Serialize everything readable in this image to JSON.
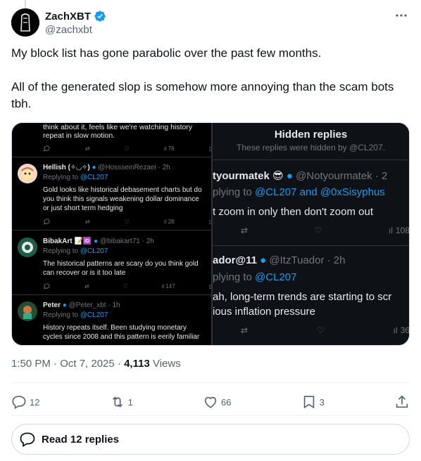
{
  "author": {
    "name": "ZachXBT",
    "handle": "@zachxbt"
  },
  "tweet": {
    "paragraph1": "My block list has gone parabolic over the past few months.",
    "paragraph2": "All of the generated slop is somehow more annoying than the scam bots tbh."
  },
  "screenshot_left": {
    "top_line1": "think about it, feels like we're watching history",
    "top_line2": "repeat in slow motion.",
    "top_views": "78",
    "replies": [
      {
        "name": "Hellish (✧◡✧)",
        "meta": "@HossseinRezaei · 2h",
        "replying_prefix": "Replying to ",
        "replying_to": "@CL207",
        "lines": [
          "Gold looks like historical debasement charts but do",
          "you think this signals weakening dollar dominance",
          "or just short term hedging"
        ],
        "views": "28"
      },
      {
        "name": "BibakArt 📝🆔",
        "meta": "@bibakart71 · 2h",
        "replying_prefix": "Replying to ",
        "replying_to": "@CL207",
        "lines": [
          "The historical patterns are scary do you think gold",
          "can recover or is it too late"
        ],
        "views": "147"
      },
      {
        "name": "Peter",
        "meta": "@Peter_xbt · 1h",
        "replying_prefix": "Replying to ",
        "replying_to": "@CL207",
        "lines": [
          "History repeats itself. Been studying monetary",
          "cycles since 2008 and this pattern is eerily familiar"
        ],
        "views": ""
      }
    ]
  },
  "screenshot_right": {
    "title": "Hidden replies",
    "subtitle": "These replies were hidden by @CL207.",
    "replies": [
      {
        "name": "tyourmatek 😎",
        "meta": "@Notyourmatek · 2",
        "replying_prefix": "plying to ",
        "replying_to": "@CL207 and @0xSisyphus",
        "lines": [
          "t zoom in only then don't zoom out"
        ],
        "views": "108"
      },
      {
        "name": "ador@11",
        "meta": "@ItzTuador · 2h",
        "replying_prefix": "plying to ",
        "replying_to": "@CL207",
        "lines": [
          "ah, long-term trends are starting to scr",
          "ious inflation pressure"
        ],
        "views": "36"
      }
    ]
  },
  "meta": {
    "time": "1:50 PM · Oct 7, 2025 · ",
    "views_count": "4,113",
    "views_label": " Views"
  },
  "actions": {
    "replies": "12",
    "reposts": "1",
    "likes": "66",
    "bookmarks": "3"
  },
  "read_replies_label": "Read 12 replies",
  "colors": {
    "accent": "#1d9bf0",
    "muted": "#536471",
    "dark_bg": "#000000"
  }
}
